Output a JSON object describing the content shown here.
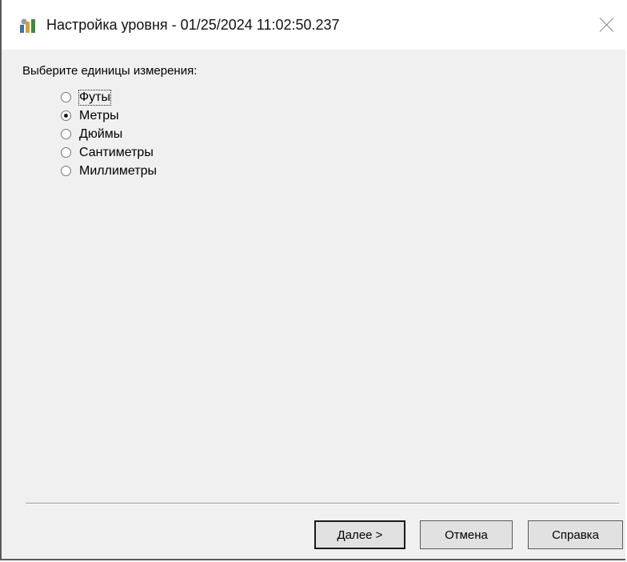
{
  "window": {
    "title": "Настройка уровня - 01/25/2024 11:02:50.237",
    "app_icon": "app-settings-icon",
    "close_icon": "close-icon"
  },
  "main": {
    "prompt": "Выберите единицы измерения:",
    "units": [
      {
        "label": "Футы",
        "checked": false,
        "focused": true
      },
      {
        "label": "Метры",
        "checked": true,
        "focused": false
      },
      {
        "label": "Дюймы",
        "checked": false,
        "focused": false
      },
      {
        "label": "Сантиметры",
        "checked": false,
        "focused": false
      },
      {
        "label": "Миллиметры",
        "checked": false,
        "focused": false
      }
    ]
  },
  "footer": {
    "next_label": "Далее >",
    "cancel_label": "Отмена",
    "help_label": "Справка"
  }
}
